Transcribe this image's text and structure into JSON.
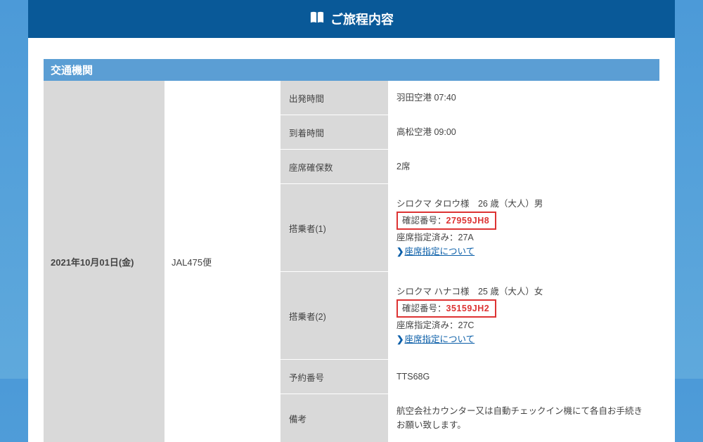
{
  "header": {
    "title": "ご旅程内容"
  },
  "section": {
    "title": "交通機関"
  },
  "date": "2021年10月01日(金)",
  "flight": "JAL475便",
  "rows": {
    "departure": {
      "label": "出発時間",
      "value": "羽田空港 07:40"
    },
    "arrival": {
      "label": "到着時間",
      "value": "高松空港 09:00"
    },
    "seats": {
      "label": "座席確保数",
      "value": "2席"
    },
    "pax1": {
      "label": "搭乗者(1)",
      "name": "シロクマ タロウ様　26 歳（大人）男",
      "conf_label": "確認番号：",
      "conf_num": "27959JH8",
      "seat": "座席指定済み：27A",
      "link": "座席指定について"
    },
    "pax2": {
      "label": "搭乗者(2)",
      "name": "シロクマ ハナコ様　25 歳（大人）女",
      "conf_label": "確認番号：",
      "conf_num": "35159JH2",
      "seat": "座席指定済み：27C",
      "link": "座席指定について"
    },
    "pnr": {
      "label": "予約番号",
      "value": "TTS68G"
    },
    "notes": {
      "label": "備考",
      "value": "航空会社カウンター又は自動チェックイン機にて各自お手続きお願い致します。"
    }
  }
}
